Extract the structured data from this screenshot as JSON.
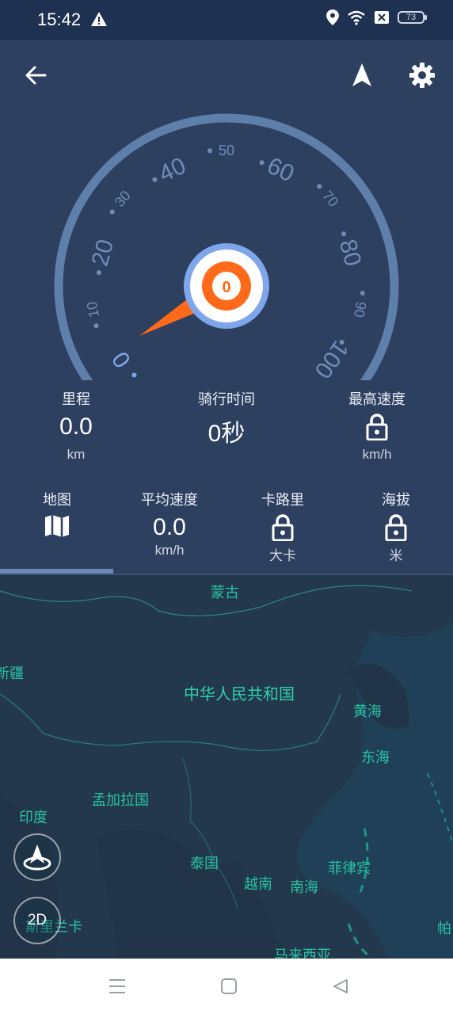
{
  "status_bar": {
    "time": "15:42",
    "battery": "73"
  },
  "gauge": {
    "ticks": [
      "0",
      "10",
      "20",
      "30",
      "40",
      "50",
      "60",
      "70",
      "80",
      "90",
      "100"
    ],
    "current_speed": "0"
  },
  "stats_top": [
    {
      "label": "里程",
      "value": "0.0",
      "unit": "km",
      "locked": false
    },
    {
      "label": "骑行时间",
      "value": "0秒",
      "unit": "",
      "locked": false
    },
    {
      "label": "最高速度",
      "value": "",
      "unit": "km/h",
      "locked": true
    }
  ],
  "stats_bottom": [
    {
      "label": "地图",
      "value": "",
      "unit": "",
      "icon": "map-icon"
    },
    {
      "label": "平均速度",
      "value": "0.0",
      "unit": "km/h",
      "locked": false
    },
    {
      "label": "卡路里",
      "value": "",
      "unit": "大卡",
      "locked": true
    },
    {
      "label": "海拔",
      "value": "",
      "unit": "米",
      "locked": true
    }
  ],
  "map": {
    "labels": {
      "mongolia": "蒙古",
      "xinjiang": "新疆",
      "china": "中华人民共和国",
      "yellow_sea": "黄海",
      "east_sea": "东海",
      "bangladesh": "孟加拉国",
      "india": "印度",
      "thailand": "泰国",
      "philippines": "菲律宾",
      "vietnam": "越南",
      "south_sea": "南海",
      "srilanka": "斯里兰卡",
      "malaysia": "马来西亚",
      "palau": "帕"
    },
    "mode_button": "2D"
  },
  "colors": {
    "background": "#2e4060",
    "status_bar": "#1f3150",
    "gauge_arc": "#5f7fab",
    "needle": "#ff6a1a",
    "hub_ring": "#7fa6ea",
    "map_water": "#1f4057",
    "map_label": "#27c3a3"
  }
}
